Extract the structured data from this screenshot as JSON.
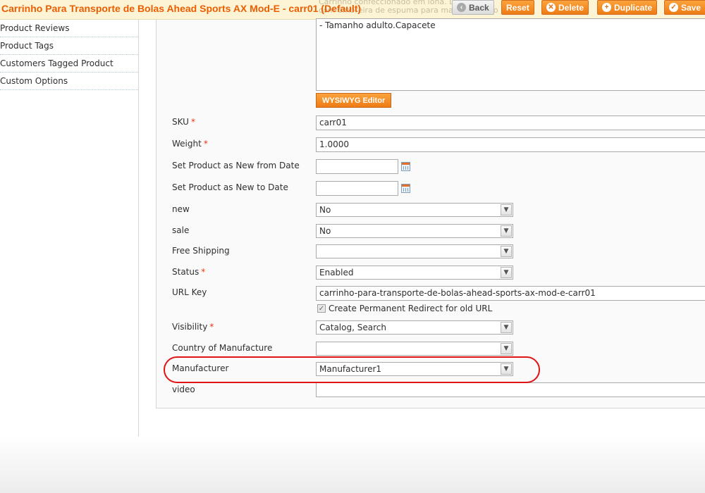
{
  "header": {
    "title": "Carrinho Para Transporte de Bolas Ahead Sports AX Mod-E - carr01 (Default)",
    "ghost_lines": [
      "Carrinho confeccionado em lona. Dimensões",
      "com ombreira de espuma para maior conforto"
    ],
    "buttons": {
      "back": "Back",
      "reset": "Reset",
      "delete": "Delete",
      "duplicate": "Duplicate",
      "save": "Save"
    }
  },
  "sidebar": {
    "items": [
      {
        "label": "Product Reviews"
      },
      {
        "label": "Product Tags"
      },
      {
        "label": "Customers Tagged Product"
      },
      {
        "label": "Custom Options"
      }
    ]
  },
  "form": {
    "description_text": "- Tamanho adulto.Capacete",
    "wysiwyg_label": "WYSIWYG Editor",
    "sku": {
      "label": "SKU",
      "value": "carr01",
      "required": "*"
    },
    "weight": {
      "label": "Weight",
      "value": "1.0000",
      "required": "*"
    },
    "new_from": {
      "label": "Set Product as New from Date",
      "value": ""
    },
    "new_to": {
      "label": "Set Product as New to Date",
      "value": ""
    },
    "new": {
      "label": "new",
      "value": "No"
    },
    "sale": {
      "label": "sale",
      "value": "No"
    },
    "free_shipping": {
      "label": "Free Shipping",
      "value": ""
    },
    "status": {
      "label": "Status",
      "value": "Enabled",
      "required": "*"
    },
    "url_key": {
      "label": "URL Key",
      "value": "carrinho-para-transporte-de-bolas-ahead-sports-ax-mod-e-carr01"
    },
    "redirect_checkbox": {
      "label": "Create Permanent Redirect for old URL",
      "checked": true
    },
    "visibility": {
      "label": "Visibility",
      "value": "Catalog, Search",
      "required": "*"
    },
    "country": {
      "label": "Country of Manufacture",
      "value": ""
    },
    "manufacturer": {
      "label": "Manufacturer",
      "value": "Manufacturer1"
    },
    "video": {
      "label": "video",
      "value": ""
    }
  },
  "colors": {
    "title": "#eb5e00",
    "button": "#f18a20",
    "required": "#eb340a",
    "highlight": "#e01414"
  },
  "icons": {
    "back": "arrow-left-icon",
    "reset": "none",
    "delete": "delete-icon",
    "duplicate": "plus-icon",
    "save": "check-icon",
    "calendar": "calendar-icon",
    "dropdown": "chevron-down-icon"
  }
}
